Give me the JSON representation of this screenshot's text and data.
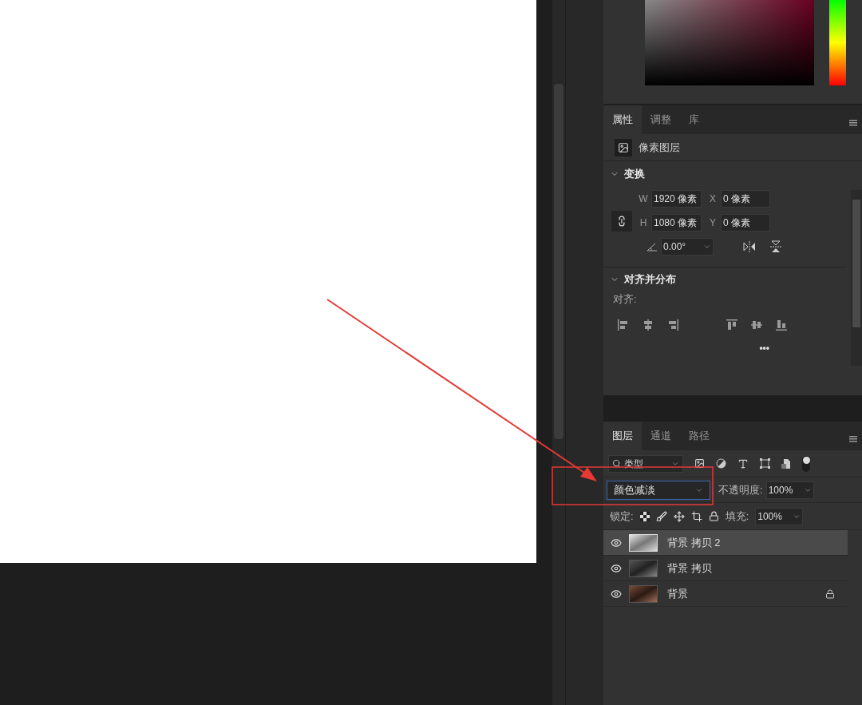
{
  "properties_panel": {
    "tabs": [
      {
        "label": "属性",
        "selected": true
      },
      {
        "label": "调整",
        "selected": false
      },
      {
        "label": "库",
        "selected": false
      }
    ],
    "layer_type": "像素图层",
    "transform": {
      "title": "变换",
      "expanded": true,
      "fields": [
        {
          "label": "W",
          "value": "1920 像素"
        },
        {
          "label": "X",
          "value": "0 像素"
        },
        {
          "label": "H",
          "value": "1080 像素"
        },
        {
          "label": "Y",
          "value": "0 像素"
        }
      ],
      "angle": "0.00°"
    },
    "align": {
      "title": "对齐并分布",
      "expanded": true,
      "label": "对齐:",
      "more": "•••"
    }
  },
  "layers_panel": {
    "tabs": [
      {
        "label": "图层",
        "selected": true
      },
      {
        "label": "通道",
        "selected": false
      },
      {
        "label": "路径",
        "selected": false
      }
    ],
    "filter": "类型",
    "blend_mode": "颜色减淡",
    "opacity_label": "不透明度:",
    "opacity": "100%",
    "lock_label": "锁定:",
    "fill_label": "填充:",
    "fill": "100%",
    "layers": [
      {
        "name": "背景 拷贝 2",
        "visible": true,
        "selected": true,
        "locked": false
      },
      {
        "name": "背景 拷贝",
        "visible": true,
        "selected": false,
        "locked": false
      },
      {
        "name": "背景",
        "visible": true,
        "selected": false,
        "locked": true
      }
    ]
  }
}
